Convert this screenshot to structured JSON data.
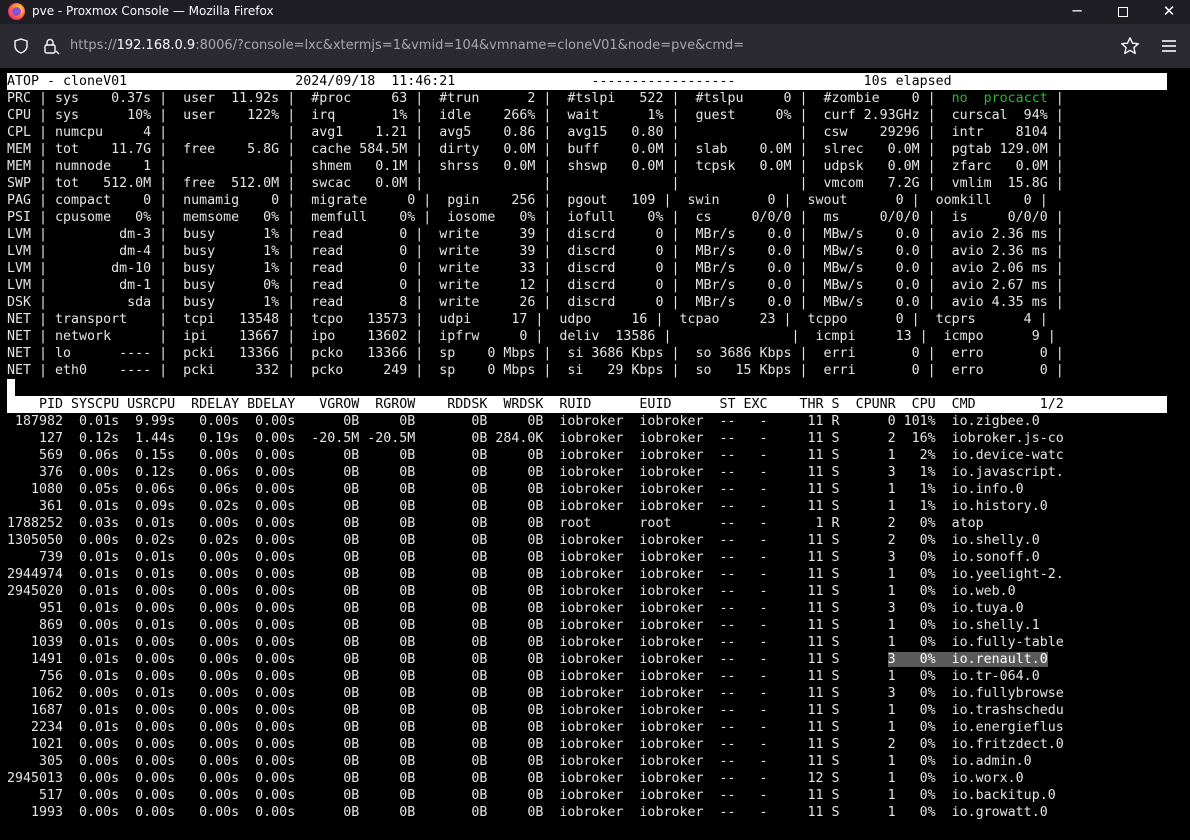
{
  "window": {
    "title": "pve - Proxmox Console — Mozilla Firefox",
    "minimize_glyph": "─",
    "close_glyph": "✕"
  },
  "urlbar": {
    "scheme": "https://",
    "host": "192.168.0.9",
    "rest": ":8006/?console=lxc&xtermjs=1&vmid=104&vmname=cloneV01&node=pve&cmd="
  },
  "atop": {
    "title_line": "ATOP - cloneV01                     2024/09/18  11:46:21                 ------------------                10s elapsed",
    "system_lines": [
      "PRC | sys    0.37s |  user  11.92s |  #proc     63 |  #trun      2 |  #tslpi   522 |  #tslpu     0 |  #zombie    0 |  ",
      "CPU | sys      10% |  user    122% |  irq       1% |  idle    266% |  wait      1% |  guest     0% |  curf 2.93GHz |  curscal  94% |",
      "CPL | numcpu     4 |               |  avg1    1.21 |  avg5    0.86 |  avg15   0.80 |               |  csw    29296 |  intr    8104 |",
      "MEM | tot    11.7G |  free    5.8G |  cache 584.5M |  dirty   0.0M |  buff    0.0M |  slab    0.0M |  slrec   0.0M |  pgtab 129.0M |",
      "MEM | numnode    1 |               |  shmem   0.1M |  shrss   0.0M |  shswp   0.0M |  tcpsk   0.0M |  udpsk   0.0M |  zfarc   0.0M |",
      "SWP | tot   512.0M |  free  512.0M |  swcac   0.0M |               |               |               |  vmcom   7.2G |  vmlim  15.8G |",
      "PAG | compact    0 |  numamig    0 |  migrate     0 |  pgin    256 |  pgout   109 |  swin      0 |  swout      0 |  oomkill    0 |",
      "PSI | cpusome   0% |  memsome   0% |  memfull    0% |  iosome   0% |  iofull    0% |  cs     0/0/0 |  ms     0/0/0 |  is     0/0/0 |",
      "LVM |         dm-3 |  busy      1% |  read       0 |  write     39 |  discrd     0 |  MBr/s    0.0 |  MBw/s    0.0 |  avio 2.36 ms |",
      "LVM |         dm-4 |  busy      1% |  read       0 |  write     39 |  discrd     0 |  MBr/s    0.0 |  MBw/s    0.0 |  avio 2.36 ms |",
      "LVM |        dm-10 |  busy      1% |  read       0 |  write     33 |  discrd     0 |  MBr/s    0.0 |  MBw/s    0.0 |  avio 2.06 ms |",
      "LVM |         dm-1 |  busy      0% |  read       0 |  write     12 |  discrd     0 |  MBr/s    0.0 |  MBw/s    0.0 |  avio 2.67 ms |",
      "DSK |          sda |  busy      1% |  read       8 |  write     26 |  discrd     0 |  MBr/s    0.0 |  MBw/s    0.0 |  avio 4.35 ms |",
      "NET | transport    |  tcpi   13548 |  tcpo   13573 |  udpi     17 |  udpo     16 |  tcpao     23 |  tcppo      0 |  tcprs      4 |",
      "NET | network      |  ipi    13667 |  ipo    13602 |  ipfrw     0 |  deliv  13586 |               |  icmpi     13 |  icmpo      9 |",
      "NET | lo      ---- |  pcki   13366 |  pcko   13366 |  sp    0 Mbps |  si 3686 Kbps |  so 3686 Kbps |  erri       0 |  erro       0 |",
      "NET | eth0    ---- |  pcki     332 |  pcko     249 |  sp    0 Mbps |  si   29 Kbps |  so   15 Kbps |  erri       0 |  erro       0 |"
    ],
    "procacct_text": "no  procacct",
    "procacct_tail": " |",
    "process_header": "    PID SYSCPU USRCPU  RDELAY BDELAY   VGROW  RGROW    RDDSK  WRDSK  RUID      EUID      ST EXC    THR S  CPUNR  CPU  CMD        1/2",
    "process_rows": [
      " 187982  0.01s  9.99s   0.00s  0.00s      0B     0B       0B     0B  iobroker  iobroker  --   -     11 R      0 101%  io.zigbee.0",
      "    127  0.12s  1.44s   0.19s  0.00s  -20.5M -20.5M       0B 284.0K  iobroker  iobroker  --   -     11 S      2  16%  iobroker.js-co",
      "    569  0.06s  0.15s   0.00s  0.00s      0B     0B       0B     0B  iobroker  iobroker  --   -     11 S      1   2%  io.device-watc",
      "    376  0.00s  0.12s   0.06s  0.00s      0B     0B       0B     0B  iobroker  iobroker  --   -     11 S      3   1%  io.javascript.",
      "   1080  0.05s  0.06s   0.06s  0.00s      0B     0B       0B     0B  iobroker  iobroker  --   -     11 S      1   1%  io.info.0",
      "    361  0.01s  0.09s   0.02s  0.00s      0B     0B       0B     0B  iobroker  iobroker  --   -     11 S      1   1%  io.history.0",
      "1788252  0.03s  0.01s   0.00s  0.00s      0B     0B       0B     0B  root      root      --   -      1 R      2   0%  atop",
      "1305050  0.00s  0.02s   0.02s  0.00s      0B     0B       0B     0B  iobroker  iobroker  --   -     11 S      2   0%  io.shelly.0",
      "    739  0.01s  0.01s   0.00s  0.00s      0B     0B       0B     0B  iobroker  iobroker  --   -     11 S      3   0%  io.sonoff.0",
      "2944974  0.01s  0.01s   0.00s  0.00s      0B     0B       0B     0B  iobroker  iobroker  --   -     11 S      1   0%  io.yeelight-2.",
      "2945020  0.01s  0.00s   0.00s  0.00s      0B     0B       0B     0B  iobroker  iobroker  --   -     11 S      1   0%  io.web.0",
      "    951  0.01s  0.00s   0.00s  0.00s      0B     0B       0B     0B  iobroker  iobroker  --   -     11 S      3   0%  io.tuya.0",
      "    869  0.00s  0.01s   0.00s  0.00s      0B     0B       0B     0B  iobroker  iobroker  --   -     11 S      1   0%  io.shelly.1",
      "   1039  0.01s  0.00s   0.00s  0.00s      0B     0B       0B     0B  iobroker  iobroker  --   -     11 S      1   0%  io.fully-table",
      "   1491  0.01s  0.00s   0.00s  0.00s      0B     0B       0B     0B  iobroker  iobroker  --   -     11 S      ",
      "    756  0.01s  0.00s   0.00s  0.00s      0B     0B       0B     0B  iobroker  iobroker  --   -     11 S      1   0%  io.tr-064.0",
      "   1062  0.00s  0.01s   0.00s  0.00s      0B     0B       0B     0B  iobroker  iobroker  --   -     11 S      3   0%  io.fullybrowse",
      "   1687  0.01s  0.00s   0.00s  0.00s      0B     0B       0B     0B  iobroker  iobroker  --   -     11 S      1   0%  io.trashschedu",
      "   2234  0.01s  0.00s   0.00s  0.00s      0B     0B       0B     0B  iobroker  iobroker  --   -     11 S      1   0%  io.energieflus",
      "   1021  0.00s  0.00s   0.00s  0.00s      0B     0B       0B     0B  iobroker  iobroker  --   -     11 S      2   0%  io.fritzdect.0",
      "    305  0.00s  0.00s   0.00s  0.00s      0B     0B       0B     0B  iobroker  iobroker  --   -     11 S      1   0%  io.admin.0",
      "2945013  0.00s  0.00s   0.00s  0.00s      0B     0B       0B     0B  iobroker  iobroker  --   -     12 S      1   0%  io.worx.0",
      "    517  0.00s  0.00s   0.00s  0.00s      0B     0B       0B     0B  iobroker  iobroker  --   -     11 S      1   0%  io.backitup.0",
      "   1993  0.00s  0.00s   0.00s  0.00s      0B     0B       0B     0B  iobroker  iobroker  --   -     11 S      1   0%  io.growatt.0"
    ],
    "highlight_text": "3   0%  io.renault.0"
  }
}
